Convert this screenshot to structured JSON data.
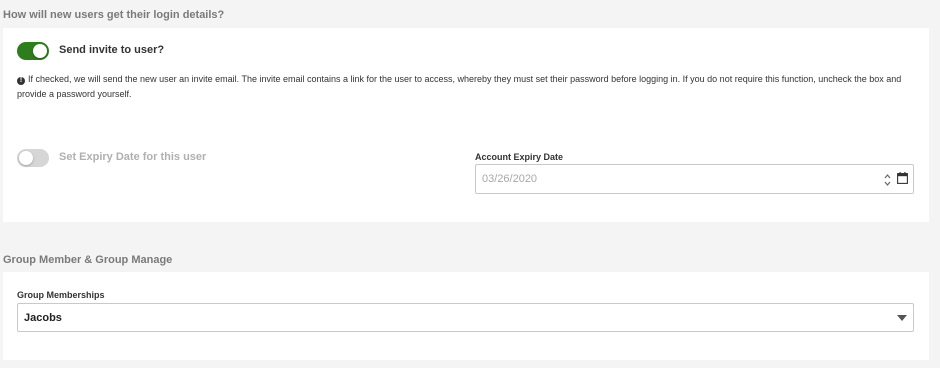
{
  "login_section": {
    "title": "How will new users get their login details?",
    "send_invite": {
      "label": "Send invite to user?",
      "checked": true,
      "info": "If checked, we will send the new user an invite email. The invite email contains a link for the user to access, whereby they must set their password before logging in. If you do not require this function, uncheck the box and provide a password yourself."
    },
    "expiry": {
      "toggle_label": "Set Expiry Date for this user",
      "checked": false,
      "field_label": "Account Expiry Date",
      "date_value": "03/26/2020"
    }
  },
  "group_section": {
    "title": "Group Member & Group Manage",
    "memberships": {
      "label": "Group Memberships",
      "selected": "Jacobs"
    }
  },
  "colors": {
    "toggle_on": "#2e7d1c",
    "toggle_off": "#d6d6d6",
    "background": "#f4f4f4"
  },
  "icons": [
    "info-icon",
    "spinner-arrows-icon",
    "calendar-icon",
    "caret-down-icon"
  ]
}
